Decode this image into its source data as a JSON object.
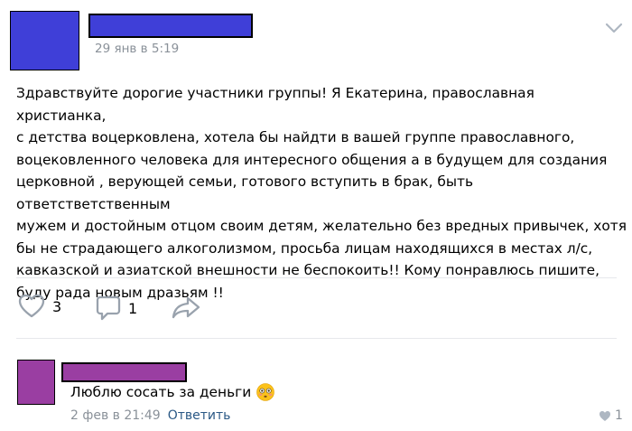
{
  "post": {
    "date": "29 янв в 5:19",
    "text": "Здравствуйте дорогие участники группы! Я Екатерина, православная христианка,\nс детства воцерковлена, хотела бы найдти в вашей группе православного,\nвоцековленного человека для интересного общения а в будущем для создания\nцерковной , верующей семьи, готового вступить в брак, быть ответстветственным\nмужем и достойным отцом своим детям, желательно без вредных привычек, хотя\nбы не страдающего алкоголизмом, просьба лицам находящихся в местах л/с,\nкавказской и азиатской внешности не беспокоить!! Кому понравлюсь пишите,\nбуду рада новым дразьям !!",
    "likes": "3",
    "comments": "1"
  },
  "comment": {
    "text": "Люблю сосать за деньги",
    "emoji": "flushed-face-icon",
    "date": "2 фев в 21:49",
    "reply_label": "Ответить",
    "likes": "1"
  },
  "colors": {
    "post_avatar": "#3f3fd8",
    "comment_avatar": "#9a3ea2",
    "link": "#2a5885",
    "meta": "#8a9199"
  }
}
